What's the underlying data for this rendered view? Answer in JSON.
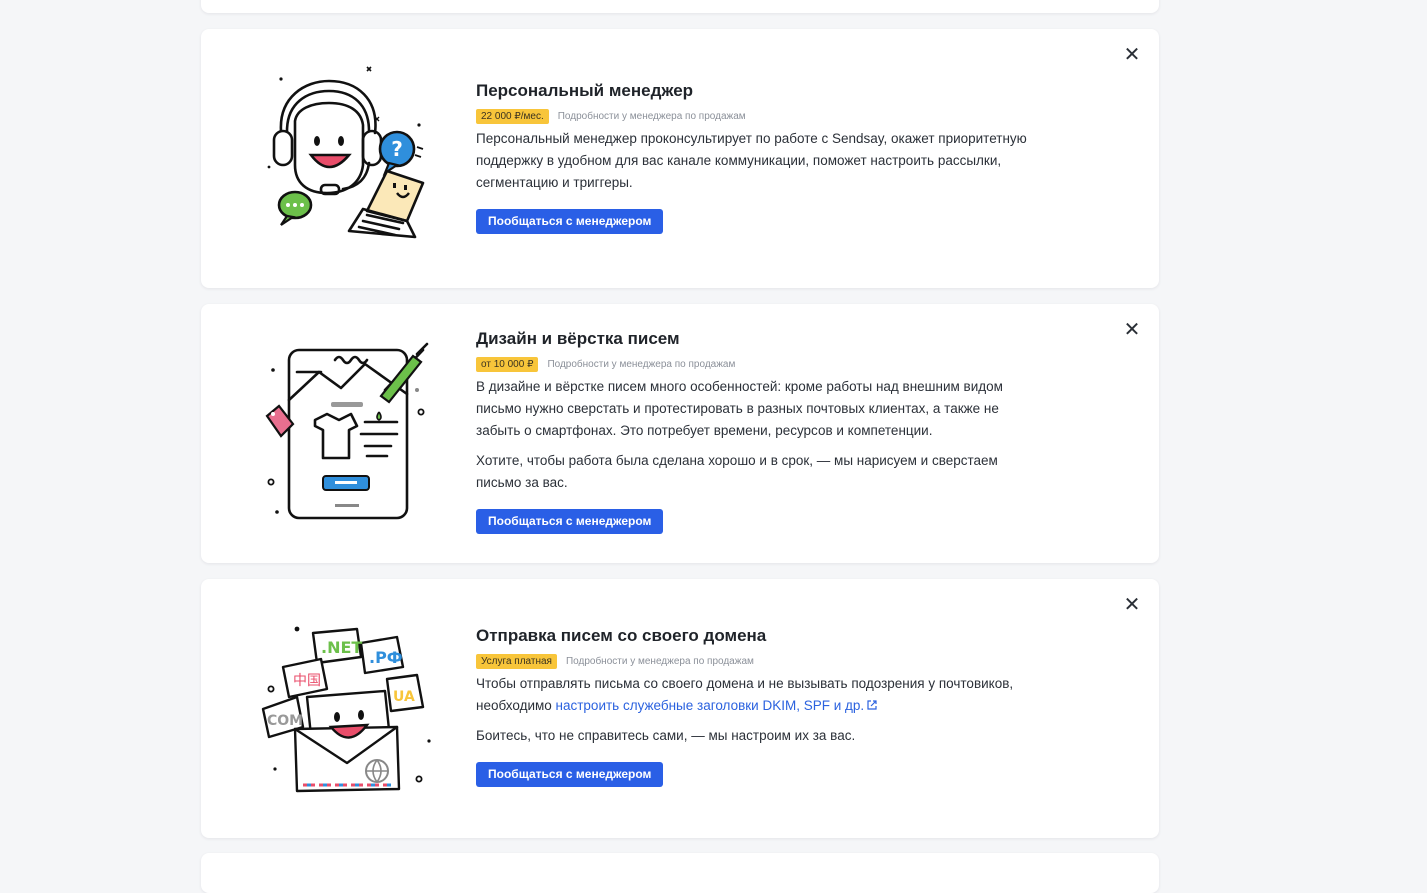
{
  "cards": [
    {
      "title": "Персональный менеджер",
      "price_badge": "22 000 ₽/мес.",
      "meta_note": "Подробности у менеджера по продажам",
      "description": [
        "Персональный менеджер проконсультирует по работе с Sendsay, окажет приоритетную поддержку в удобном для вас канале коммуникации, поможет настроить рассылки, сегментацию и триггеры."
      ],
      "button_label": "Пообщаться с менеджером",
      "illustration_icon": "headset-support-icon",
      "close_icon": "close-icon"
    },
    {
      "title": "Дизайн и вёрстка писем",
      "price_badge": "от 10 000 ₽",
      "meta_note": "Подробности у менеджера по продажам",
      "description": [
        "В дизайне и вёрстке писем много особенностей: кроме работы над внешним видом письмо нужно сверстать и протестировать в разных почтовых клиентах, а также не забыть о смартфонах. Это потребует времени, ресурсов и компетенции.",
        "Хотите, чтобы работа была сделана хорошо и в срок, — мы нарисуем и сверстаем письмо за вас."
      ],
      "button_label": "Пообщаться с менеджером",
      "illustration_icon": "email-design-icon",
      "close_icon": "close-icon"
    },
    {
      "title": "Отправка писем со своего домена",
      "price_badge": "Услуга платная",
      "meta_note": "Подробности у менеджера по продажам",
      "description_prefix": "Чтобы отправлять письма со своего домена и не вызывать подозрения у почтовиков, необходимо ",
      "description_link": "настроить служебные заголовки DKIM, SPF и др.",
      "description_2": "Боитесь, что не справитесь сами, — мы настроим их за вас.",
      "button_label": "Пообщаться с менеджером",
      "illustration_icon": "domain-envelope-icon",
      "illustration_labels": [
        ".NET",
        ".РФ",
        "中国",
        "COM",
        "UA"
      ],
      "close_icon": "close-icon"
    }
  ],
  "colors": {
    "accent": "#2a5fe6",
    "badge": "#f8c53a",
    "link": "#2b62df",
    "background": "#f5f6f8"
  }
}
